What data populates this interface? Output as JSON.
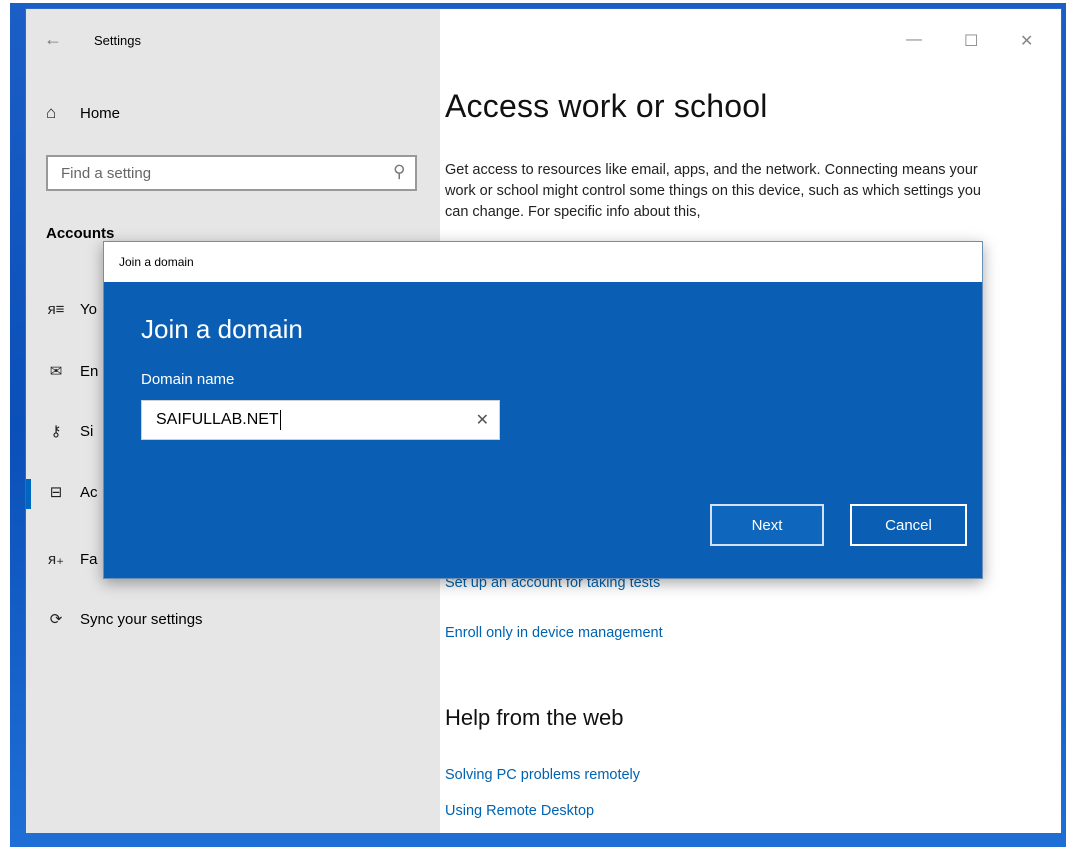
{
  "window": {
    "title": "Settings",
    "controls": {
      "minimize": "—",
      "maximize": "☐",
      "close": "✕"
    }
  },
  "sidebar": {
    "home_label": "Home",
    "search_placeholder": "Find a setting",
    "section_header": "Accounts",
    "items": [
      {
        "icon": "person-list-icon",
        "label": "Yo"
      },
      {
        "icon": "mail-icon",
        "label": "En"
      },
      {
        "icon": "key-icon",
        "label": "Si"
      },
      {
        "icon": "briefcase-icon",
        "label": "Ac",
        "active": true
      },
      {
        "icon": "add-person-icon",
        "label": "Fa"
      },
      {
        "icon": "sync-icon",
        "label": "Sync your settings"
      }
    ]
  },
  "content": {
    "title": "Access work or school",
    "description": "Get access to resources like email, apps, and the network. Connecting means your work or school might control some things on this device, such as which settings you can change. For specific info about this,",
    "links": {
      "test_account": "Set up an account for taking tests",
      "enroll": "Enroll only in device management"
    },
    "help": {
      "title": "Help from the web",
      "links": [
        "Solving PC problems remotely",
        "Using Remote Desktop"
      ]
    }
  },
  "dialog": {
    "window_title": "Join a domain",
    "heading": "Join a domain",
    "field_label": "Domain name",
    "field_value": "SAIFULLAB.NET",
    "next_label": "Next",
    "cancel_label": "Cancel"
  },
  "colors": {
    "dialog_bg": "#0a5fb4",
    "link": "#0063b1",
    "sidebar_bg": "#e6e6e6",
    "accent": "#0067c0"
  }
}
